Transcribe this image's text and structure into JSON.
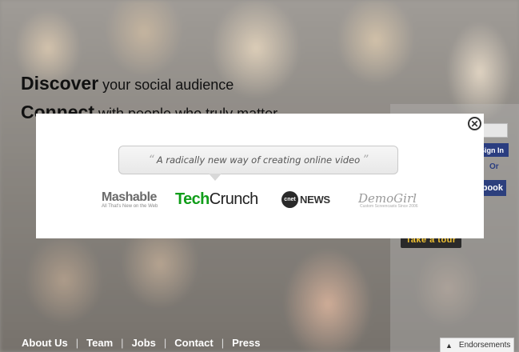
{
  "hero": {
    "line1_bold": "Discover",
    "line1_rest": " your social audience",
    "line2_bold": "Connect",
    "line2_rest": " with people who truly matter"
  },
  "side_panel": {
    "signin_label": "Sign In",
    "or_label": "Or",
    "facebook_label": "book",
    "tour_label": "Take a tour"
  },
  "modal": {
    "quote": "A radically new way of creating online video",
    "close_icon": "close-icon",
    "logos": {
      "mashable_name": "Mashable",
      "mashable_sub": "All That's New on the Web",
      "tc_tech": "Tech",
      "tc_crunch": "Crunch",
      "cnet_mark": "cnet",
      "cnet_news": "NEWS",
      "demogirl_name": "DemoGirl",
      "demogirl_sub": "Custom Screencasts Since 2006"
    }
  },
  "footer": {
    "links": [
      "About Us",
      "Team",
      "Jobs",
      "Contact",
      "Press"
    ],
    "endorsements_label": "Endorsements",
    "endorsements_icon": "caret-up-icon"
  },
  "colors": {
    "tc_green": "#119e1a",
    "fb_blue": "#2c3f7d",
    "tour_yellow": "#f1c232"
  }
}
